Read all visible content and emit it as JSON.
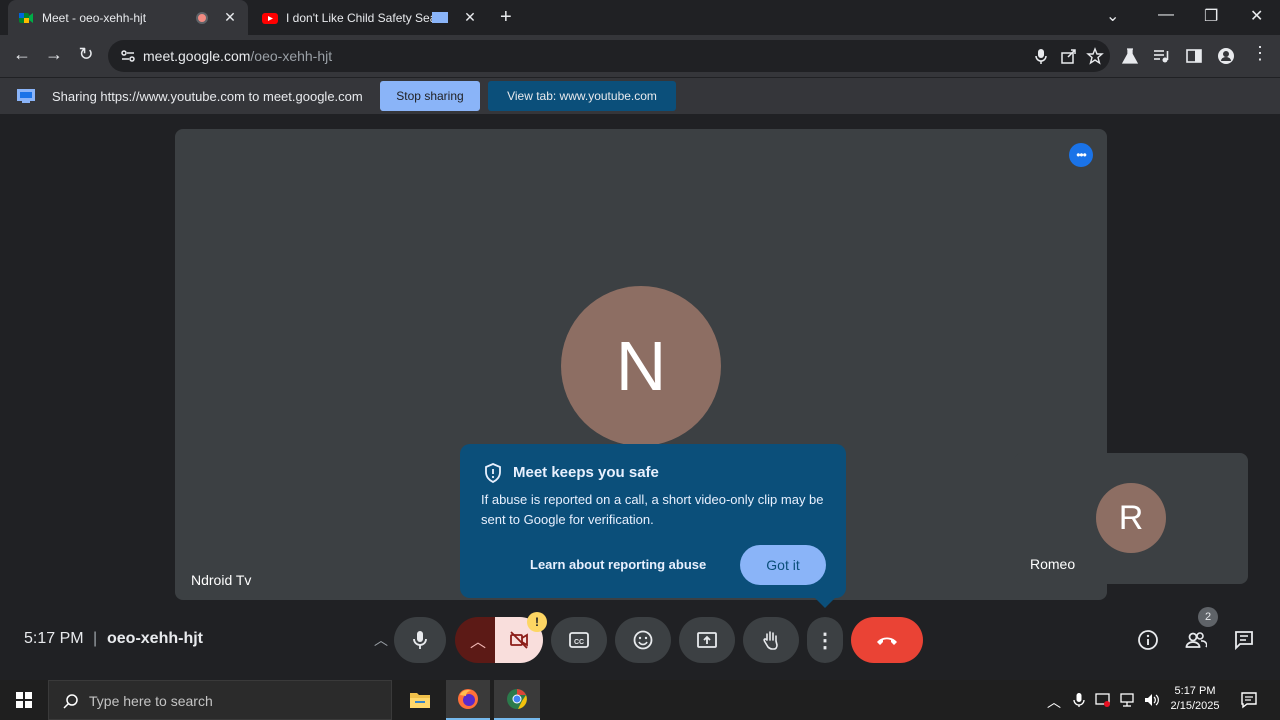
{
  "browser": {
    "tabs": [
      {
        "title": "Meet - oeo-xehh-hjt",
        "active": true
      },
      {
        "title": "I don't Like Child Safety Seat",
        "active": false
      }
    ],
    "url_host": "meet.google.com",
    "url_path": "/oeo-xehh-hjt"
  },
  "sharebar": {
    "text": "Sharing https://www.youtube.com to meet.google.com",
    "stop_label": "Stop sharing",
    "viewtab_label": "View tab: www.youtube.com"
  },
  "meet": {
    "main_participant": {
      "initial": "N",
      "name": "Ndroid Tv"
    },
    "self_participant": {
      "initial": "R",
      "name": "Romeo"
    },
    "popup": {
      "title": "Meet keeps you safe",
      "body": "If abuse is reported on a call, a short video-only clip may be sent to Google for verification.",
      "link_label": "Learn about reporting abuse",
      "button_label": "Got it"
    },
    "time": "5:17 PM",
    "separator": "|",
    "meeting_code": "oeo-xehh-hjt",
    "warning_badge": "!",
    "people_count": "2"
  },
  "taskbar": {
    "search_placeholder": "Type here to search",
    "clock_time": "5:17 PM",
    "clock_date": "2/15/2025"
  },
  "colors": {
    "accent": "#8ab4f8",
    "end_call": "#ea4335",
    "popup_bg": "#0b4f7a",
    "avatar": "#8d6e63"
  }
}
